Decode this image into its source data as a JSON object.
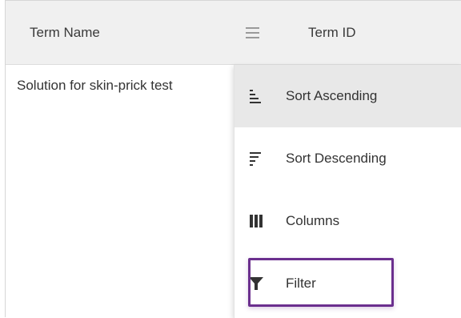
{
  "grid": {
    "columns": [
      {
        "header": "Term Name"
      },
      {
        "header": "Term ID"
      }
    ],
    "rows": [
      {
        "term_name": "Solution for skin-prick test"
      }
    ]
  },
  "column_menu": {
    "items": [
      {
        "label": "Sort Ascending",
        "icon": "sort-ascending-icon",
        "highlighted": true
      },
      {
        "label": "Sort Descending",
        "icon": "sort-descending-icon",
        "highlighted": false
      },
      {
        "label": "Columns",
        "icon": "columns-icon",
        "highlighted": false
      },
      {
        "label": "Filter",
        "icon": "filter-icon",
        "highlighted": false,
        "outlined": true
      }
    ]
  },
  "colors": {
    "header_bg": "#f0f0f0",
    "highlight_bg": "#e8e8e8",
    "outline_accent": "#6b2f8e",
    "icon": "#333333"
  }
}
